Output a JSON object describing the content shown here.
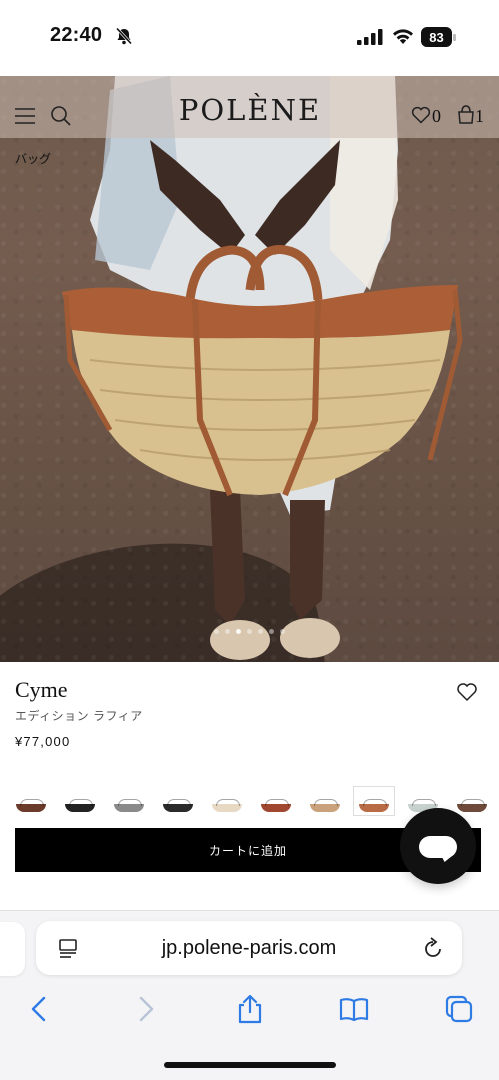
{
  "status_bar": {
    "time": "22:40",
    "battery": "83"
  },
  "header": {
    "logo": "POLÈNE",
    "wishlist_count": "0",
    "cart_count": "1"
  },
  "breadcrumb": "バッグ",
  "product": {
    "name": "Cyme",
    "edition": "エディション ラフィア",
    "price": "¥77,000",
    "add_to_cart": "カートに追加"
  },
  "swatches": [
    {
      "color": "#6b3a2a"
    },
    {
      "color": "#222222"
    },
    {
      "color": "#8a8a8a"
    },
    {
      "color": "#2a2a2a"
    },
    {
      "color": "#e8d9c4"
    },
    {
      "color": "#a0472f"
    },
    {
      "color": "#c9a27c"
    },
    {
      "color": "#b86b45",
      "selected": true
    },
    {
      "color": "#c7d2cf"
    },
    {
      "color": "#6e4a3a"
    }
  ],
  "browser": {
    "url": "jp.polene-paris.com"
  },
  "colors": {
    "accent": "#000000",
    "hero_ground": "#6e5a4d"
  }
}
